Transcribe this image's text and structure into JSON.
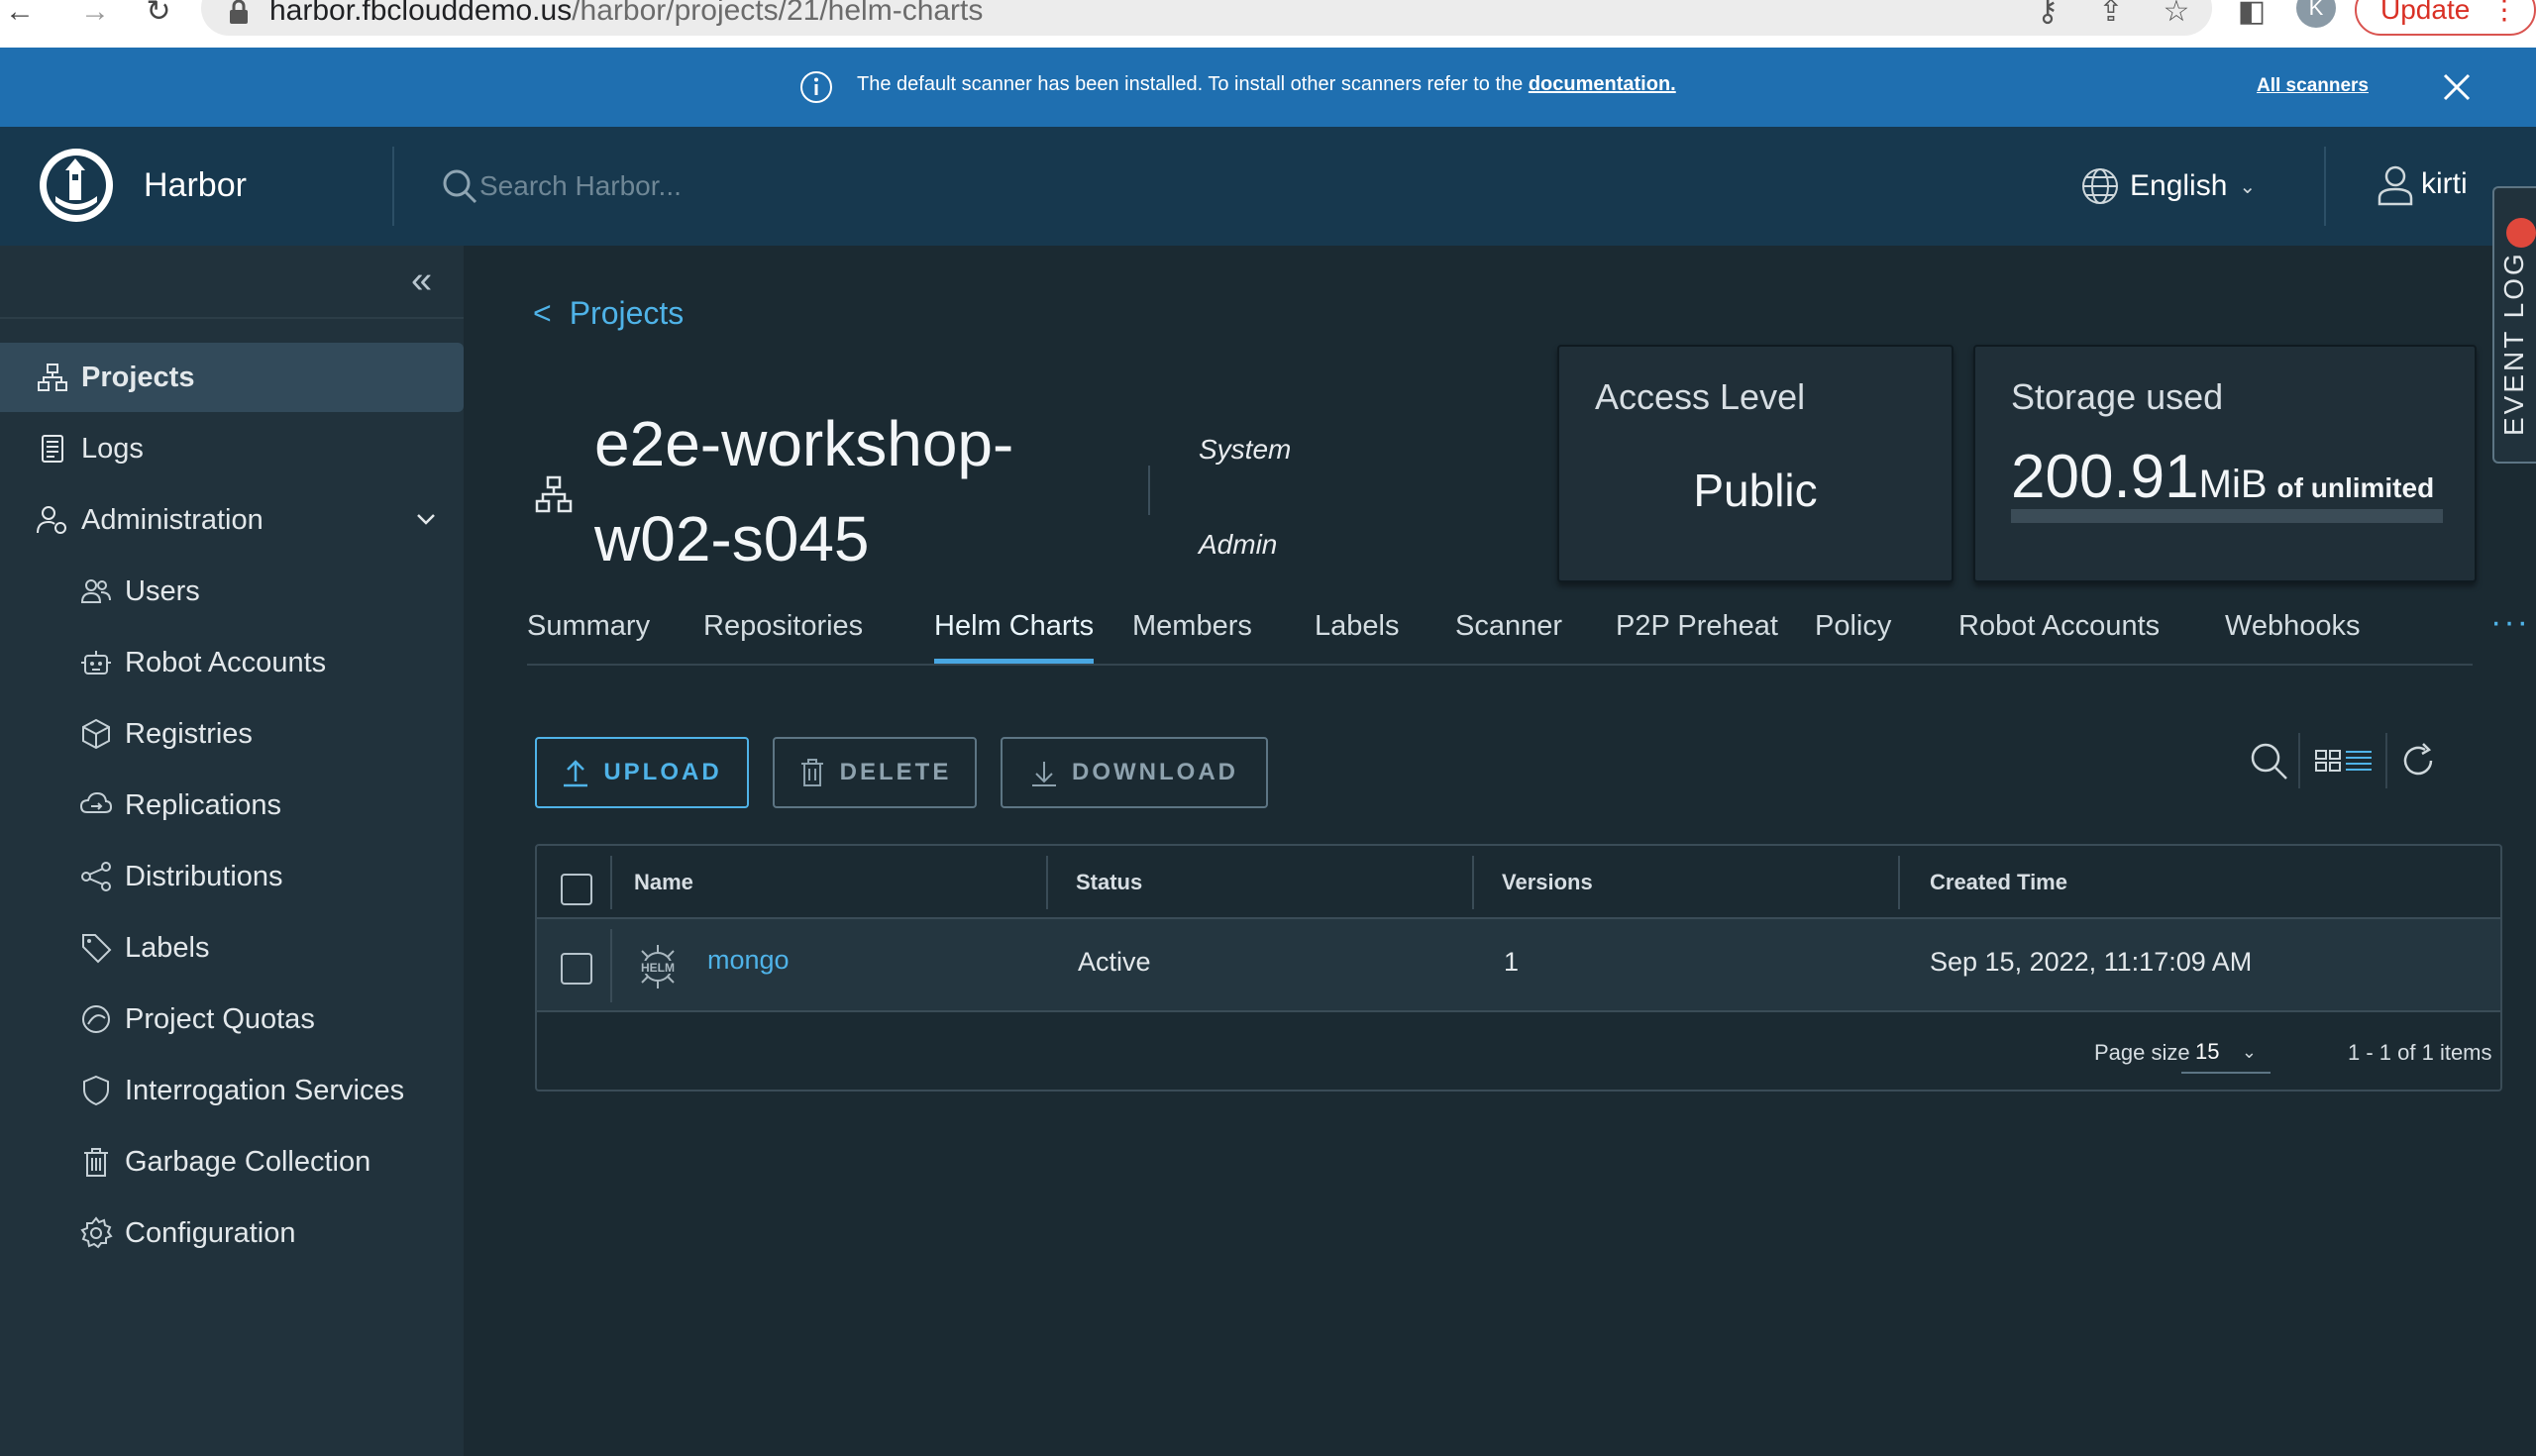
{
  "browser": {
    "url_host": "harbor.fbclouddemo.us",
    "url_path": "/harbor/projects/21/helm-charts",
    "profile_initial": "K",
    "update_label": "Update"
  },
  "banner": {
    "message": "The default scanner has been installed. To install other scanners refer to the",
    "doc_link": "documentation.",
    "all_scanners": "All scanners"
  },
  "header": {
    "brand": "Harbor",
    "search_placeholder": "Search Harbor...",
    "language": "English",
    "user": "kirti"
  },
  "sidebar": {
    "items": [
      {
        "label": "Projects",
        "icon": "projects-icon",
        "active": true
      },
      {
        "label": "Logs",
        "icon": "logs-icon"
      },
      {
        "label": "Administration",
        "icon": "administration-icon",
        "expanded": true
      }
    ],
    "admin_items": [
      {
        "label": "Users",
        "icon": "users-icon"
      },
      {
        "label": "Robot Accounts",
        "icon": "robot-icon"
      },
      {
        "label": "Registries",
        "icon": "registries-icon"
      },
      {
        "label": "Replications",
        "icon": "replications-icon"
      },
      {
        "label": "Distributions",
        "icon": "distributions-icon"
      },
      {
        "label": "Labels",
        "icon": "labels-icon"
      },
      {
        "label": "Project Quotas",
        "icon": "quotas-icon"
      },
      {
        "label": "Interrogation Services",
        "icon": "shield-icon"
      },
      {
        "label": "Garbage Collection",
        "icon": "trash-icon"
      },
      {
        "label": "Configuration",
        "icon": "gear-icon"
      }
    ]
  },
  "project": {
    "breadcrumb_arrow": "<",
    "breadcrumb": "Projects",
    "name_line1": "e2e-workshop-",
    "name_line2": "w02-s045",
    "role_top": "System",
    "role_bottom": "Admin",
    "access_level_title": "Access Level",
    "access_level_value": "Public",
    "storage_title": "Storage used",
    "storage_number": "200.91",
    "storage_unit": "MiB",
    "storage_of": "of unlimited"
  },
  "tabs": [
    "Summary",
    "Repositories",
    "Helm Charts",
    "Members",
    "Labels",
    "Scanner",
    "P2P Preheat",
    "Policy",
    "Robot Accounts",
    "Webhooks"
  ],
  "tabs_more": "···",
  "active_tab": "Helm Charts",
  "toolbar": {
    "upload": "UPLOAD",
    "delete": "DELETE",
    "download": "DOWNLOAD"
  },
  "table": {
    "columns": [
      "Name",
      "Status",
      "Versions",
      "Created Time"
    ],
    "rows": [
      {
        "name": "mongo",
        "status": "Active",
        "versions": "1",
        "created": "Sep 15, 2022, 11:17:09 AM"
      }
    ],
    "page_size_label": "Page size",
    "page_size": "15",
    "pagination": "1 - 1 of 1 items"
  },
  "event_log": {
    "label": "EVENT LOG",
    "badge_color": "#e0483c"
  },
  "colors": {
    "accent": "#4fb3e8",
    "banner": "#1f6fb0",
    "header": "#17384e",
    "sidebar": "#21323c",
    "main": "#1b2a32"
  }
}
